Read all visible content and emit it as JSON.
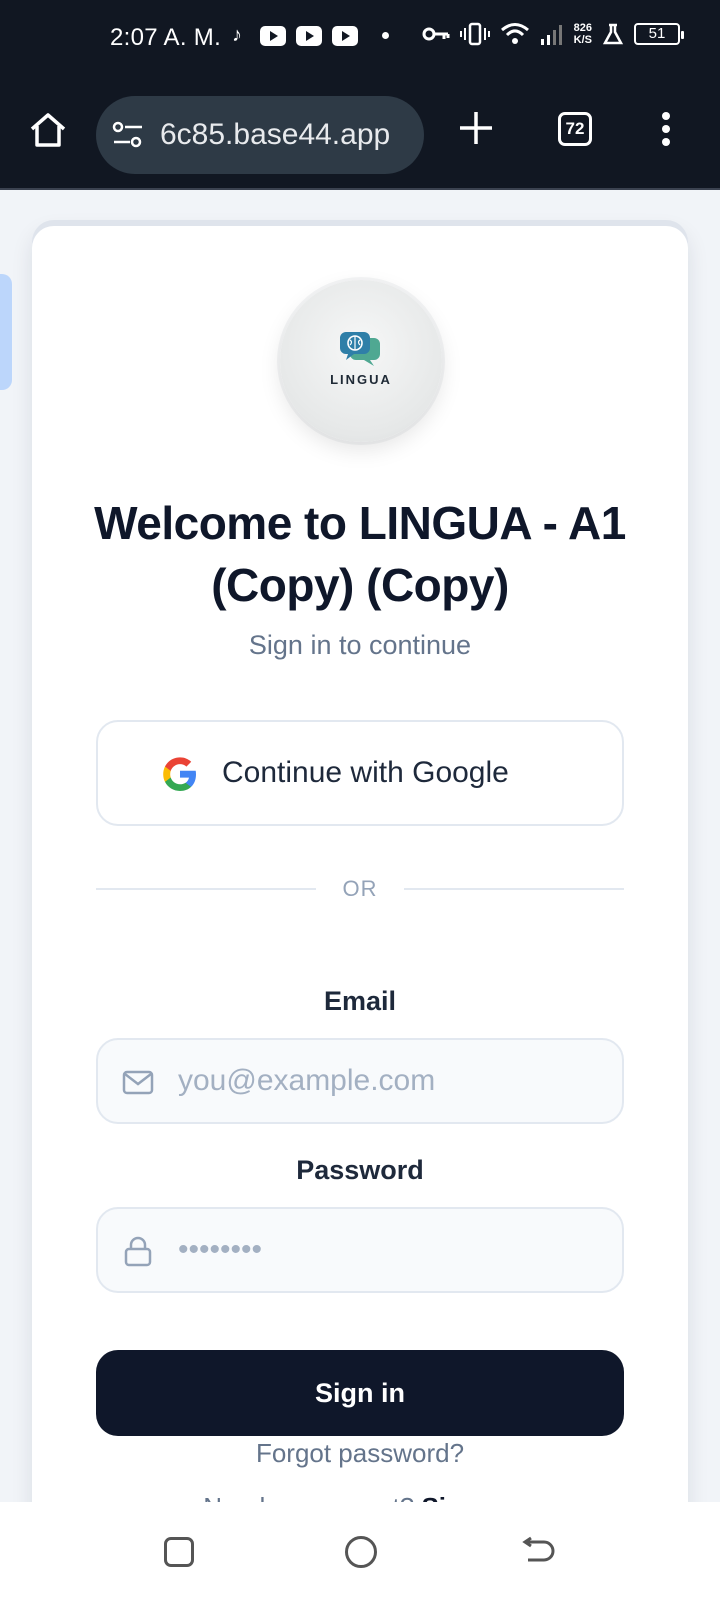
{
  "status_bar": {
    "time": "2:07 A. M.",
    "net_speed_value": "826",
    "net_speed_unit": "K/S",
    "battery": "51"
  },
  "browser": {
    "url": "6c85.base44.app",
    "tab_count": "72"
  },
  "login": {
    "logo_text": "LINGUA",
    "title": "Welcome to LINGUA - A1 (Copy) (Copy)",
    "subtitle": "Sign in to continue",
    "google_label": "Continue with Google",
    "divider": "OR",
    "email_label": "Email",
    "email_placeholder": "you@example.com",
    "password_label": "Password",
    "password_placeholder": "••••••••",
    "signin_label": "Sign in",
    "forgot_label": "Forgot password?",
    "need_account": "Need an account?",
    "signup_label": "Sign up"
  },
  "colors": {
    "primary": "#0f172a",
    "muted": "#64748b",
    "border": "#e2e8f0",
    "browser_bg": "#111722"
  }
}
